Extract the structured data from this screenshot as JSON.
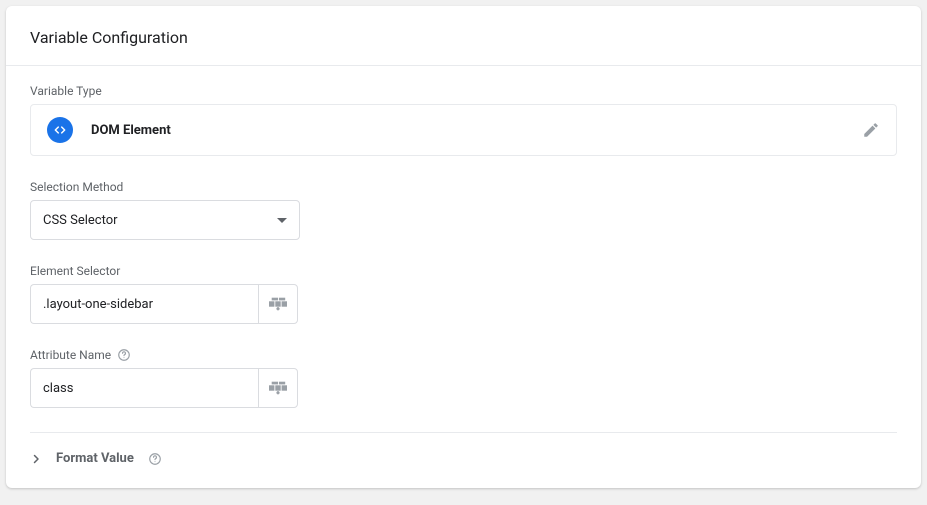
{
  "header": {
    "title": "Variable Configuration"
  },
  "variableType": {
    "label": "Variable Type",
    "name": "DOM Element"
  },
  "selectionMethod": {
    "label": "Selection Method",
    "value": "CSS Selector"
  },
  "elementSelector": {
    "label": "Element Selector",
    "value": ".layout-one-sidebar"
  },
  "attributeName": {
    "label": "Attribute Name",
    "value": "class"
  },
  "formatValue": {
    "label": "Format Value"
  }
}
